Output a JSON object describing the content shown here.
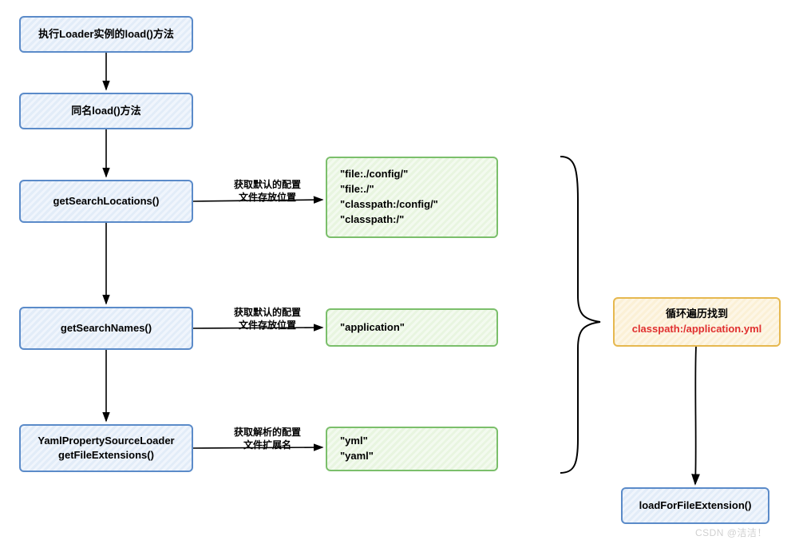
{
  "boxes": {
    "b1": "执行Loader实例的load()方法",
    "b2": "同名load()方法",
    "b3": "getSearchLocations()",
    "b4": "getSearchNames()",
    "b5_line1": "YamlPropertySourceLoader",
    "b5_line2": "getFileExtensions()",
    "b6": "loadForFileExtension()"
  },
  "green": {
    "g1_l1": "\"file:./config/\"",
    "g1_l2": "\"file:./\"",
    "g1_l3": "\"classpath:/config/\"",
    "g1_l4": "\"classpath:/\"",
    "g2_l1": "\"application\"",
    "g3_l1": "\"yml\"",
    "g3_l2": "\"yaml\""
  },
  "yellow": {
    "y_line1": "循环遍历找到",
    "y_line2": "classpath:/application.yml"
  },
  "labels": {
    "l1_line1": "获取默认的配置",
    "l1_line2": "文件存放位置",
    "l2_line1": "获取默认的配置",
    "l2_line2": "文件存放位置",
    "l3_line1": "获取解析的配置",
    "l3_line2": "文件扩展名"
  },
  "watermark": "CSDN @洁洁！"
}
